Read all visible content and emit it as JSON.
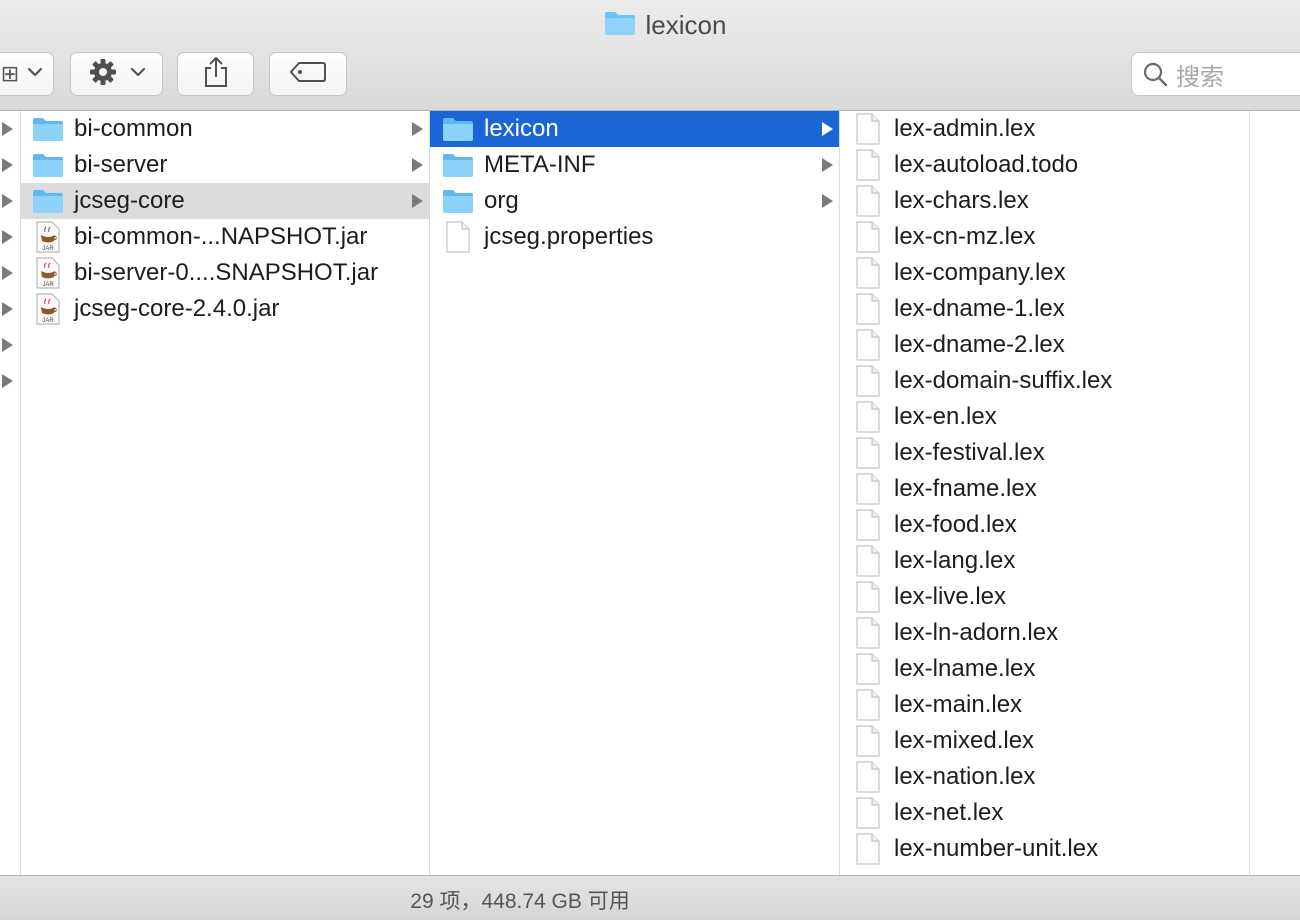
{
  "window": {
    "title": "lexicon"
  },
  "toolbar": {
    "view_glyph": "⊞"
  },
  "search": {
    "placeholder": "搜索"
  },
  "columns": {
    "col1": [
      {
        "name": "bi-common",
        "kind": "folder",
        "has_children": true
      },
      {
        "name": "bi-server",
        "kind": "folder",
        "has_children": true
      },
      {
        "name": "jcseg-core",
        "kind": "folder",
        "has_children": true
      },
      {
        "name": "bi-common-...NAPSHOT.jar",
        "kind": "jar",
        "has_children": false
      },
      {
        "name": "bi-server-0....SNAPSHOT.jar",
        "kind": "jar",
        "has_children": false
      },
      {
        "name": "jcseg-core-2.4.0.jar",
        "kind": "jar",
        "has_children": false
      }
    ],
    "col2": [
      {
        "name": "lexicon",
        "kind": "folder",
        "has_children": true
      },
      {
        "name": "META-INF",
        "kind": "folder",
        "has_children": true
      },
      {
        "name": "org",
        "kind": "folder",
        "has_children": true
      },
      {
        "name": "jcseg.properties",
        "kind": "file",
        "has_children": false
      }
    ],
    "col3": [
      "lex-admin.lex",
      "lex-autoload.todo",
      "lex-chars.lex",
      "lex-cn-mz.lex",
      "lex-company.lex",
      "lex-dname-1.lex",
      "lex-dname-2.lex",
      "lex-domain-suffix.lex",
      "lex-en.lex",
      "lex-festival.lex",
      "lex-fname.lex",
      "lex-food.lex",
      "lex-lang.lex",
      "lex-live.lex",
      "lex-ln-adorn.lex",
      "lex-lname.lex",
      "lex-main.lex",
      "lex-mixed.lex",
      "lex-nation.lex",
      "lex-net.lex",
      "lex-number-unit.lex"
    ]
  },
  "selection": {
    "col1": "jcseg-core",
    "col2": "lexicon"
  },
  "status": {
    "text": "29 项，448.74 GB 可用"
  },
  "colors": {
    "selection_blue": "#1a66d6",
    "folder_blue": "#6cc3f5",
    "toolbar_grey": "#e0e0e0"
  },
  "icons": {
    "folder": "folder-icon",
    "file": "file-icon",
    "jar": "jar-icon",
    "search": "search-icon",
    "gear": "gear-icon",
    "share": "share-icon",
    "tag": "tag-icon"
  }
}
